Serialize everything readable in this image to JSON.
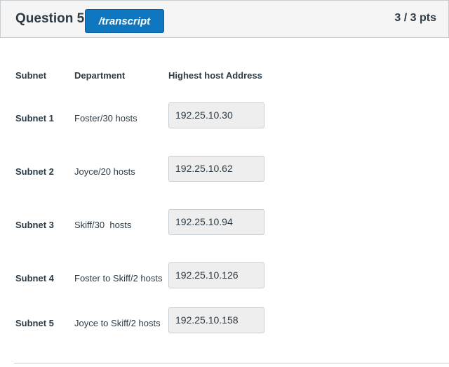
{
  "question": {
    "title": "Question 5",
    "transcript_label": "/transcript",
    "points": "3 / 3 pts"
  },
  "columns": {
    "subnet": "Subnet",
    "department": "Department",
    "highest": "Highest host Address"
  },
  "rows": [
    {
      "subnet": "Subnet 1",
      "department": "Foster/30 hosts",
      "answer": "192.25.10.30"
    },
    {
      "subnet": "Subnet 2",
      "department": "Joyce/20 hosts",
      "answer": "192.25.10.62"
    },
    {
      "subnet": "Subnet 3",
      "department": "Skiff/30  hosts",
      "answer": "192.25.10.94"
    },
    {
      "subnet": "Subnet 4",
      "department": "Foster to Skiff/2 hosts",
      "answer": "192.25.10.126"
    },
    {
      "subnet": "Subnet 5",
      "department": "Joyce to Skiff/2 hosts",
      "answer": "192.25.10.158"
    }
  ]
}
